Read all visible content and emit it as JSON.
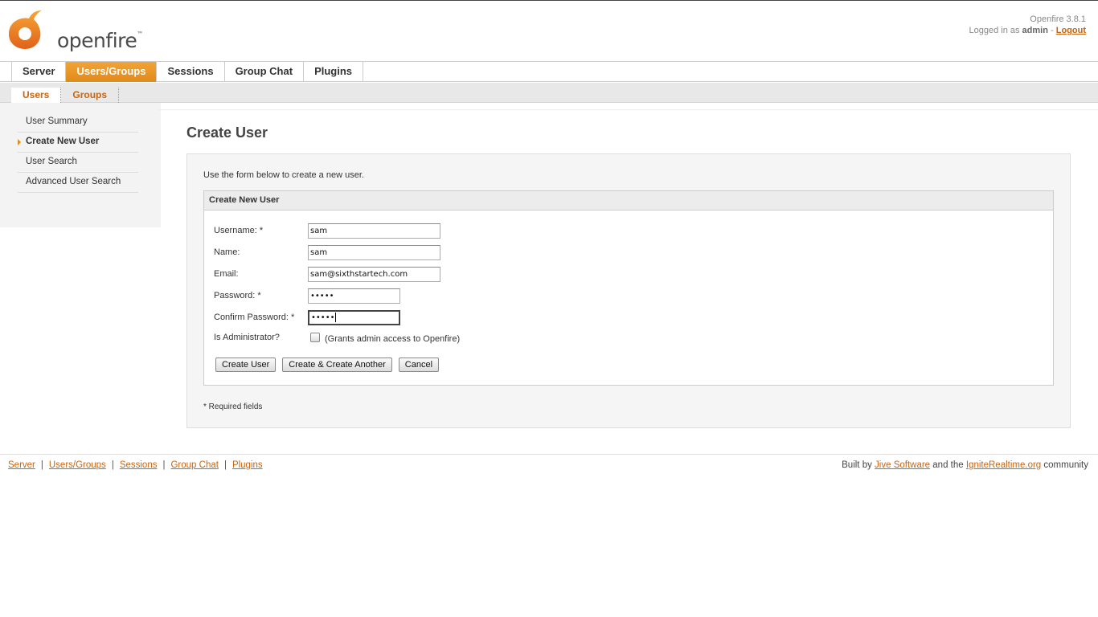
{
  "brand": {
    "logo_text": "openfire",
    "trademark": "™",
    "version": "Openfire 3.8.1",
    "logged_in_prefix": "Logged in as",
    "user": "admin",
    "separator": " - ",
    "logout": "Logout",
    "accent_color": "#e08b1a",
    "link_color": "#c86510"
  },
  "main_tabs": [
    {
      "label": "Server",
      "active": false
    },
    {
      "label": "Users/Groups",
      "active": true
    },
    {
      "label": "Sessions",
      "active": false
    },
    {
      "label": "Group Chat",
      "active": false
    },
    {
      "label": "Plugins",
      "active": false
    }
  ],
  "sub_tabs": [
    {
      "label": "Users",
      "active": true
    },
    {
      "label": "Groups",
      "active": false
    }
  ],
  "sidebar": {
    "items": [
      {
        "label": "User Summary",
        "active": false
      },
      {
        "label": "Create New User",
        "active": true
      },
      {
        "label": "User Search",
        "active": false
      },
      {
        "label": "Advanced User Search",
        "active": false
      }
    ]
  },
  "page": {
    "title": "Create User",
    "intro": "Use the form below to create a new user.",
    "box_title": "Create New User",
    "required_note": "* Required fields"
  },
  "form": {
    "username": {
      "label": "Username: *",
      "value": "sam"
    },
    "name": {
      "label": "Name:",
      "value": "sam"
    },
    "email": {
      "label": "Email:",
      "value": "sam@sixthstartech.com"
    },
    "password": {
      "label": "Password: *",
      "value": "•••••"
    },
    "confirm_password": {
      "label": "Confirm Password: *",
      "value": "•••••"
    },
    "is_admin": {
      "label": "Is Administrator?",
      "note": "(Grants admin access to Openfire)",
      "checked": false
    }
  },
  "buttons": {
    "create": "Create User",
    "create_another": "Create & Create Another",
    "cancel": "Cancel"
  },
  "footer": {
    "links": [
      "Server",
      "Users/Groups",
      "Sessions",
      "Group Chat",
      "Plugins"
    ],
    "separator": "|",
    "credit_prefix": "Built by",
    "credit_link1": "Jive Software",
    "credit_mid": "and the",
    "credit_link2": "IgniteRealtime.org",
    "credit_suffix": "community"
  }
}
